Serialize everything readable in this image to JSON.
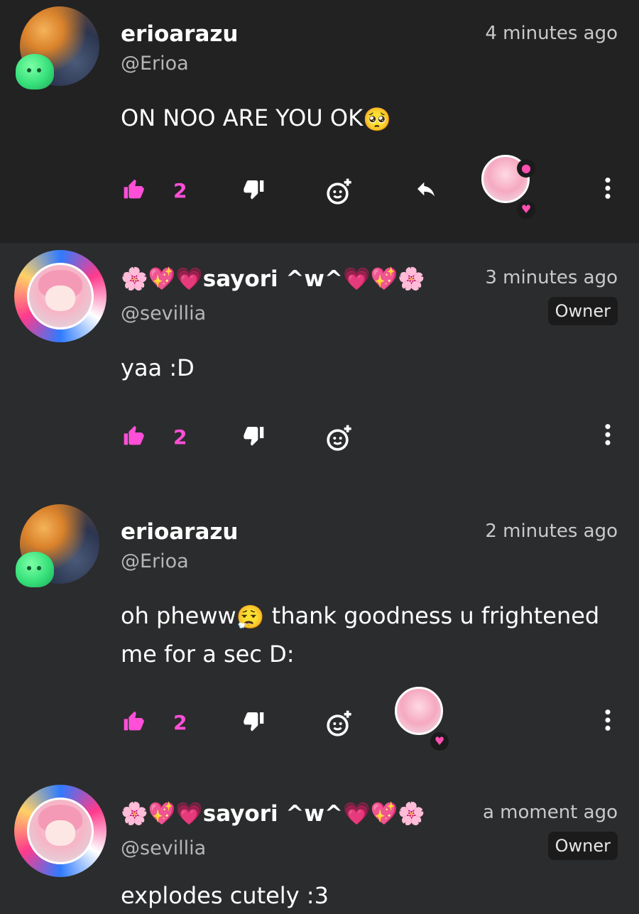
{
  "comments": [
    {
      "username": "erioarazu",
      "handle": "@Erioa",
      "time": "4 minutes ago",
      "body": "ON NOO ARE YOU OK",
      "body_emoji": "🥺",
      "likes": "2",
      "has_reply": true
    },
    {
      "username": "🌸💖💗sayori ^w^💗💖🌸",
      "handle": "@sevillia",
      "time": "3 minutes ago",
      "badge": "Owner",
      "body": "yaa :D",
      "likes": "2"
    },
    {
      "username": "erioarazu",
      "handle": "@Erioa",
      "time": "2 minutes ago",
      "body_part1": "oh pheww",
      "body_emoji": "😮‍💨",
      "body_part2": " thank goodness u frightened me for a sec D:",
      "likes": "2"
    },
    {
      "username": "🌸💖💗sayori ^w^💗💖🌸",
      "handle": "@sevillia",
      "time": "a moment ago",
      "badge": "Owner",
      "body": "explodes cutely :3"
    }
  ],
  "colors": {
    "accent_pink": "#ff4fd8",
    "background": "#2b2c2d",
    "highlight_background": "#222223",
    "muted_text": "#b6b6b6"
  },
  "icons": {
    "like": "thumbs-up-icon",
    "dislike": "thumbs-down-icon",
    "react": "add-reaction-icon",
    "reply": "reply-icon",
    "more": "more-vertical-icon"
  }
}
